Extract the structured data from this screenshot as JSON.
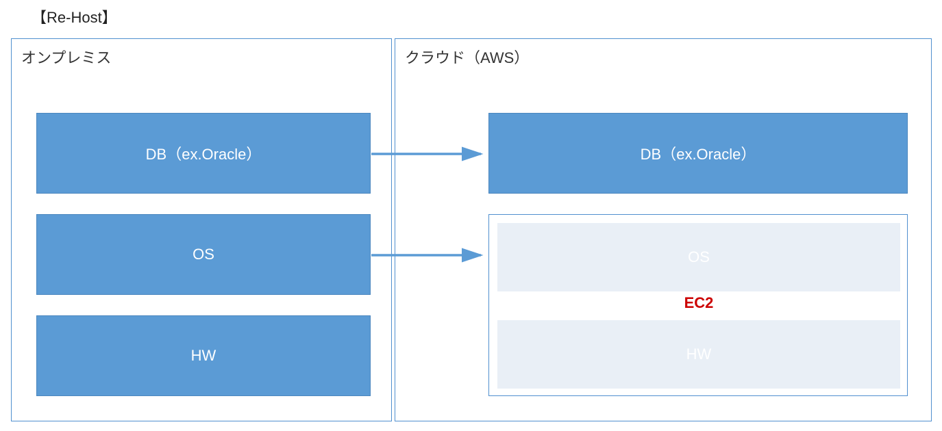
{
  "title": "【Re-Host】",
  "left": {
    "title": "オンプレミス",
    "db": "DB（ex.Oracle）",
    "os": "OS",
    "hw": "HW"
  },
  "right": {
    "title": "クラウド（AWS）",
    "db": "DB（ex.Oracle）",
    "ec2_label": "EC2",
    "os": "OS",
    "hw": "HW"
  },
  "colors": {
    "box_fill": "#5b9bd5",
    "box_border": "#4a86be",
    "panel_border": "#4f8fcf",
    "faded_fill": "#e9eff6",
    "ec2_red": "#cc0000",
    "arrow": "#5b9bd5"
  }
}
